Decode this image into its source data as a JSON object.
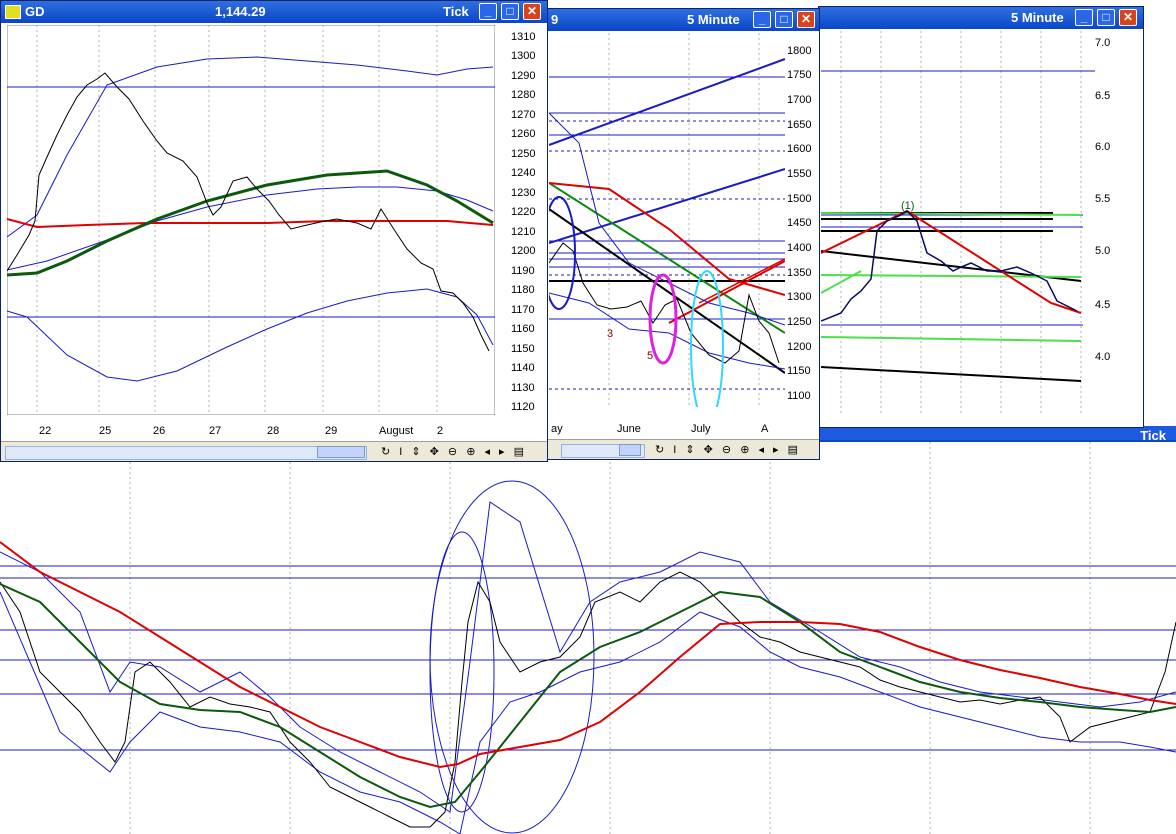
{
  "windows": {
    "gd": {
      "symbol": "GD",
      "price": "1,144.29",
      "interval": "Tick",
      "yticks": [
        "1310",
        "1300",
        "1290",
        "1280",
        "1270",
        "1260",
        "1250",
        "1240",
        "1230",
        "1220",
        "1210",
        "1200",
        "1190",
        "1180",
        "1170",
        "1160",
        "1150",
        "1140",
        "1130",
        "1120"
      ],
      "xticks": [
        "22",
        "25",
        "26",
        "27",
        "28",
        "29",
        "August",
        "2"
      ]
    },
    "mid": {
      "title_suffix": "9",
      "interval": "5 Minute",
      "yticks": [
        "1800",
        "1750",
        "1700",
        "1650",
        "1600",
        "1550",
        "1500",
        "1450",
        "1400",
        "1350",
        "1300",
        "1250",
        "1200",
        "1150",
        "1100"
      ],
      "xticks": [
        "ay",
        "June",
        "July",
        "A"
      ],
      "labels": [
        "3",
        "5"
      ]
    },
    "right": {
      "interval": "5 Minute",
      "yticks": [
        "7.0",
        "6.5",
        "6.0",
        "5.5",
        "5.0",
        "4.5",
        "4.0"
      ],
      "wave_label": "(1)"
    },
    "bottom": {
      "interval": "Tick"
    }
  },
  "colors": {
    "titlebar": "#0a46c8",
    "price": "#000000",
    "band": "#1a1ac8",
    "ma_red": "#e00000",
    "ma_green": "#0b5a0b",
    "magenta": "#e020e0",
    "cyan": "#30d8ff"
  }
}
